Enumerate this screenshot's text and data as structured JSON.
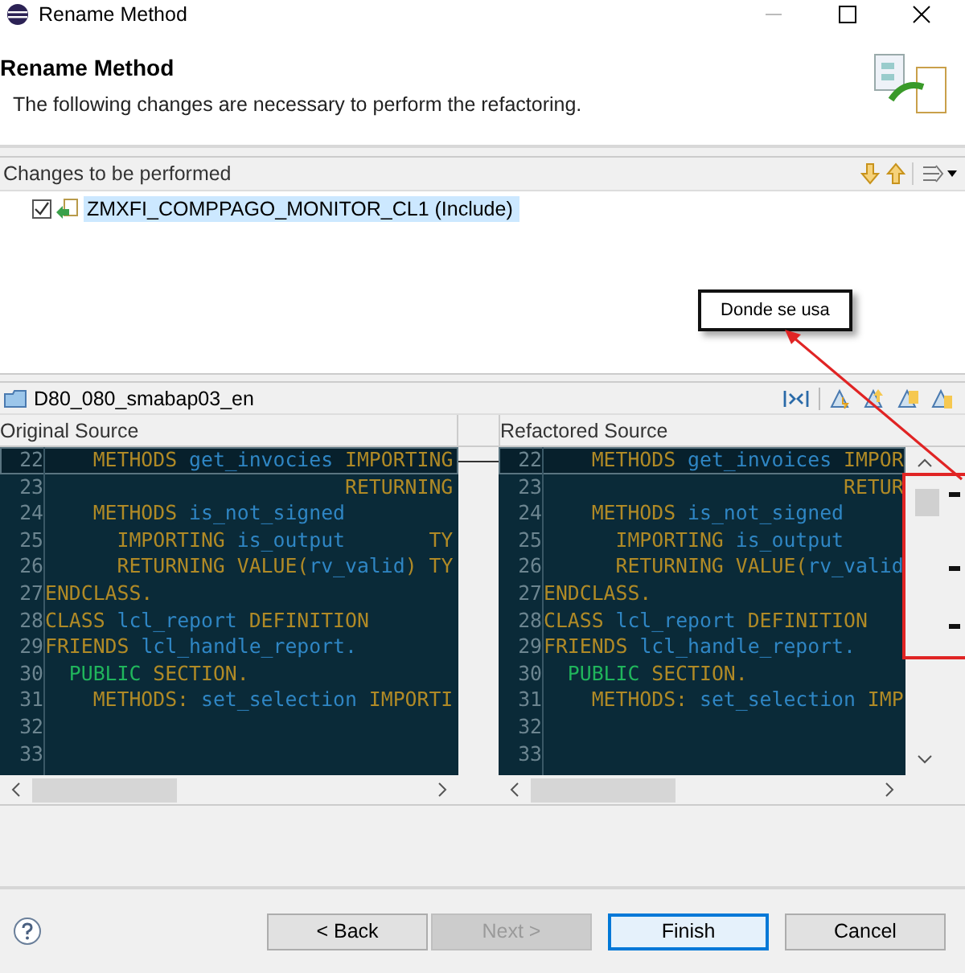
{
  "window": {
    "title": "Rename Method"
  },
  "header": {
    "title": "Rename Method",
    "message": "The following changes are necessary to perform the refactoring."
  },
  "changes": {
    "title": "Changes to be performed",
    "items": [
      {
        "label": "ZMXFI_COMPPAGO_MONITOR_CL1 (Include)",
        "checked": true,
        "selected": true
      }
    ]
  },
  "annotation": {
    "label": "Donde se usa"
  },
  "compare": {
    "title": "D80_080_smabap03_en",
    "left_title": "Original Source",
    "right_title": "Refactored Source",
    "left_lines": [
      {
        "number": "22",
        "changed": true,
        "segments": [
          {
            "text": "    METHODS ",
            "kind": "keyword"
          },
          {
            "text": "get_invocies ",
            "kind": "name"
          },
          {
            "text": "IMPORTING",
            "kind": "keyword"
          }
        ]
      },
      {
        "number": "23",
        "changed": false,
        "segments": [
          {
            "text": "                         RETURNING",
            "kind": "keyword"
          }
        ]
      },
      {
        "number": "24",
        "changed": false,
        "segments": [
          {
            "text": "    METHODS ",
            "kind": "keyword"
          },
          {
            "text": "is_not_signed",
            "kind": "name"
          }
        ]
      },
      {
        "number": "25",
        "changed": false,
        "segments": [
          {
            "text": "      IMPORTING ",
            "kind": "keyword"
          },
          {
            "text": "is_output       ",
            "kind": "name"
          },
          {
            "text": "TY",
            "kind": "keyword"
          }
        ]
      },
      {
        "number": "26",
        "changed": false,
        "segments": [
          {
            "text": "      RETURNING VALUE(",
            "kind": "keyword"
          },
          {
            "text": "rv_valid",
            "kind": "name"
          },
          {
            "text": ") TY",
            "kind": "keyword"
          }
        ]
      },
      {
        "number": "27",
        "changed": false,
        "segments": [
          {
            "text": "ENDCLASS.",
            "kind": "keyword"
          }
        ]
      },
      {
        "number": "28",
        "changed": false,
        "segments": [
          {
            "text": "CLASS ",
            "kind": "keyword"
          },
          {
            "text": "lcl_report ",
            "kind": "name"
          },
          {
            "text": "DEFINITION",
            "kind": "keyword"
          }
        ]
      },
      {
        "number": "29",
        "changed": false,
        "segments": [
          {
            "text": "FRIENDS ",
            "kind": "keyword"
          },
          {
            "text": "lcl_handle_report.",
            "kind": "name"
          }
        ]
      },
      {
        "number": "30",
        "changed": false,
        "segments": [
          {
            "text": "  PUBLIC ",
            "kind": "access"
          },
          {
            "text": "SECTION.",
            "kind": "keyword"
          }
        ]
      },
      {
        "number": "31",
        "changed": false,
        "segments": [
          {
            "text": "    METHODS: ",
            "kind": "keyword"
          },
          {
            "text": "set_selection ",
            "kind": "name"
          },
          {
            "text": "IMPORTI",
            "kind": "keyword"
          }
        ]
      },
      {
        "number": "32",
        "changed": false
      },
      {
        "number": "33",
        "changed": false
      }
    ],
    "right_lines": [
      {
        "number": "22",
        "changed": true,
        "segments": [
          {
            "text": "    METHODS ",
            "kind": "keyword"
          },
          {
            "text": "get_invoices ",
            "kind": "name"
          },
          {
            "text": "IMPOR",
            "kind": "keyword"
          }
        ]
      },
      {
        "number": "23",
        "changed": false,
        "segments": [
          {
            "text": "                         RETUR",
            "kind": "keyword"
          }
        ]
      },
      {
        "number": "24",
        "changed": false,
        "segments": [
          {
            "text": "    METHODS ",
            "kind": "keyword"
          },
          {
            "text": "is_not_signed",
            "kind": "name"
          }
        ]
      },
      {
        "number": "25",
        "changed": false,
        "segments": [
          {
            "text": "      IMPORTING ",
            "kind": "keyword"
          },
          {
            "text": "is_output",
            "kind": "name"
          }
        ]
      },
      {
        "number": "26",
        "changed": false,
        "segments": [
          {
            "text": "      RETURNING VALUE(",
            "kind": "keyword"
          },
          {
            "text": "rv_valid",
            "kind": "name"
          }
        ]
      },
      {
        "number": "27",
        "changed": false,
        "segments": [
          {
            "text": "ENDCLASS.",
            "kind": "keyword"
          }
        ]
      },
      {
        "number": "28",
        "changed": false,
        "segments": [
          {
            "text": "CLASS ",
            "kind": "keyword"
          },
          {
            "text": "lcl_report ",
            "kind": "name"
          },
          {
            "text": "DEFINITION",
            "kind": "keyword"
          }
        ]
      },
      {
        "number": "29",
        "changed": false,
        "segments": [
          {
            "text": "FRIENDS ",
            "kind": "keyword"
          },
          {
            "text": "lcl_handle_report.",
            "kind": "name"
          }
        ]
      },
      {
        "number": "30",
        "changed": false,
        "segments": [
          {
            "text": "  PUBLIC ",
            "kind": "access"
          },
          {
            "text": "SECTION.",
            "kind": "keyword"
          }
        ]
      },
      {
        "number": "31",
        "changed": false,
        "segments": [
          {
            "text": "    METHODS: ",
            "kind": "keyword"
          },
          {
            "text": "set_selection ",
            "kind": "name"
          },
          {
            "text": "IMP",
            "kind": "keyword"
          }
        ]
      },
      {
        "number": "32",
        "changed": false
      },
      {
        "number": "33",
        "changed": false
      }
    ]
  },
  "buttons": [
    {
      "label": "< Back",
      "disabled": false,
      "default": false
    },
    {
      "label": "Next >",
      "disabled": true,
      "default": false
    },
    {
      "label": "Finish",
      "disabled": false,
      "default": true
    },
    {
      "label": "Cancel",
      "disabled": false,
      "default": false
    }
  ]
}
